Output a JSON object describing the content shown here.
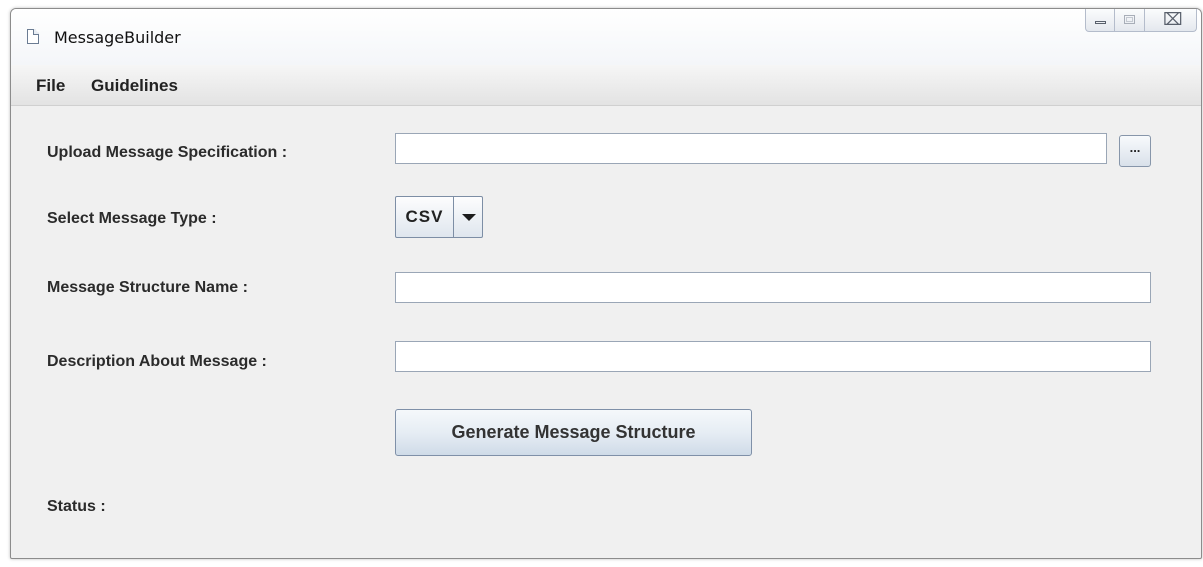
{
  "window": {
    "title": "MessageBuilder",
    "controls": {
      "minimize": "minimize-icon",
      "maximize": "maximize-icon",
      "close": "close-icon",
      "close_glyph": "⌧"
    }
  },
  "menu": {
    "items": [
      {
        "label": "File"
      },
      {
        "label": "Guidelines"
      }
    ]
  },
  "form": {
    "upload_label": "Upload Message Specification :",
    "upload_value": "",
    "browse_label": "...",
    "type_label": "Select Message Type :",
    "type_value": "CSV",
    "name_label": "Message Structure Name :",
    "name_value": "",
    "description_label": "Description About Message :",
    "description_value": "",
    "generate_label": "Generate Message Structure",
    "status_label": "Status :",
    "status_value": ""
  }
}
